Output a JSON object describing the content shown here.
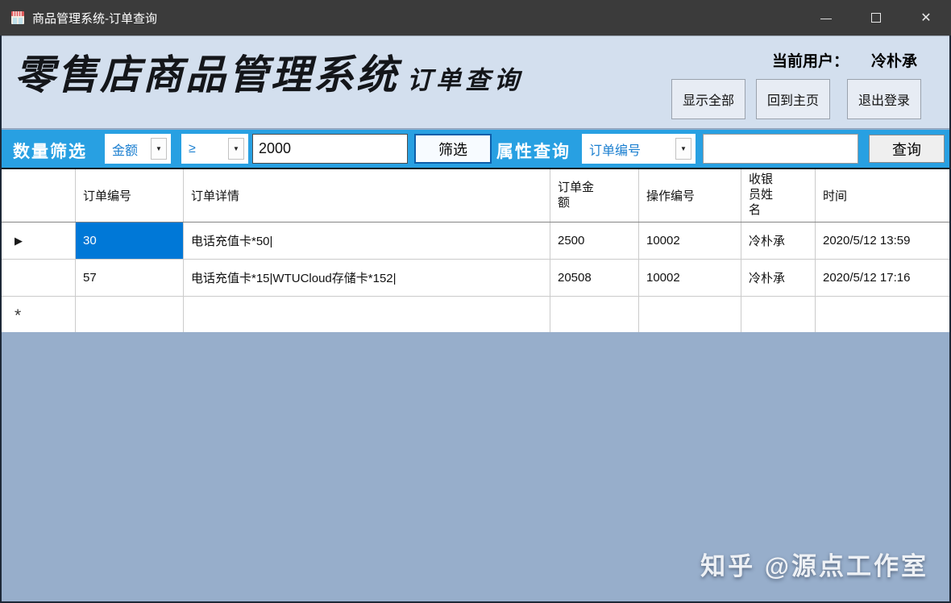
{
  "window": {
    "title": "商品管理系统-订单查询",
    "minimize_glyph": "—",
    "close_glyph": "✕"
  },
  "header": {
    "brand_main": "零售店商品管理系统",
    "brand_sub": "订单查询",
    "current_user_label": "当前用户：",
    "current_user_name": "冷朴承",
    "buttons": [
      {
        "label": "显示全部"
      },
      {
        "label": "回到主页"
      },
      {
        "label": "退出登录"
      }
    ]
  },
  "filter_bar": {
    "quantity_filter_label": "数量筛选",
    "field_select_value": "金额",
    "operator_select_value": "≥",
    "value_input": "2000",
    "filter_button_label": "筛选",
    "attribute_query_label": "属性查询",
    "attribute_select_value": "订单编号",
    "attribute_input_value": "",
    "query_button_label": "查询"
  },
  "table": {
    "columns": [
      "订单编号",
      "订单详情",
      "订单金额",
      "操作编号",
      "收银员姓名",
      "时间"
    ],
    "rows": [
      {
        "selector": "▶",
        "cells": [
          "30",
          "电话充值卡*50|",
          "2500",
          "10002",
          "冷朴承",
          "2020/5/12 13:59"
        ]
      },
      {
        "selector": "",
        "cells": [
          "57",
          "电话充值卡*15|WTUCloud存储卡*152|",
          "20508",
          "10002",
          "冷朴承",
          "2020/5/12 17:16"
        ]
      },
      {
        "selector": "*",
        "cells": [
          "",
          "",
          "",
          "",
          "",
          ""
        ]
      }
    ]
  },
  "watermark": "知乎 @源点工作室",
  "colors": {
    "titlebar": "#3b3b3b",
    "header_bg": "#d3dfee",
    "filterbar_accent": "#28a0e2",
    "selection_blue": "#0078d7",
    "backdrop": "#97aecb",
    "combo_text_blue": "#1b7fd0"
  }
}
